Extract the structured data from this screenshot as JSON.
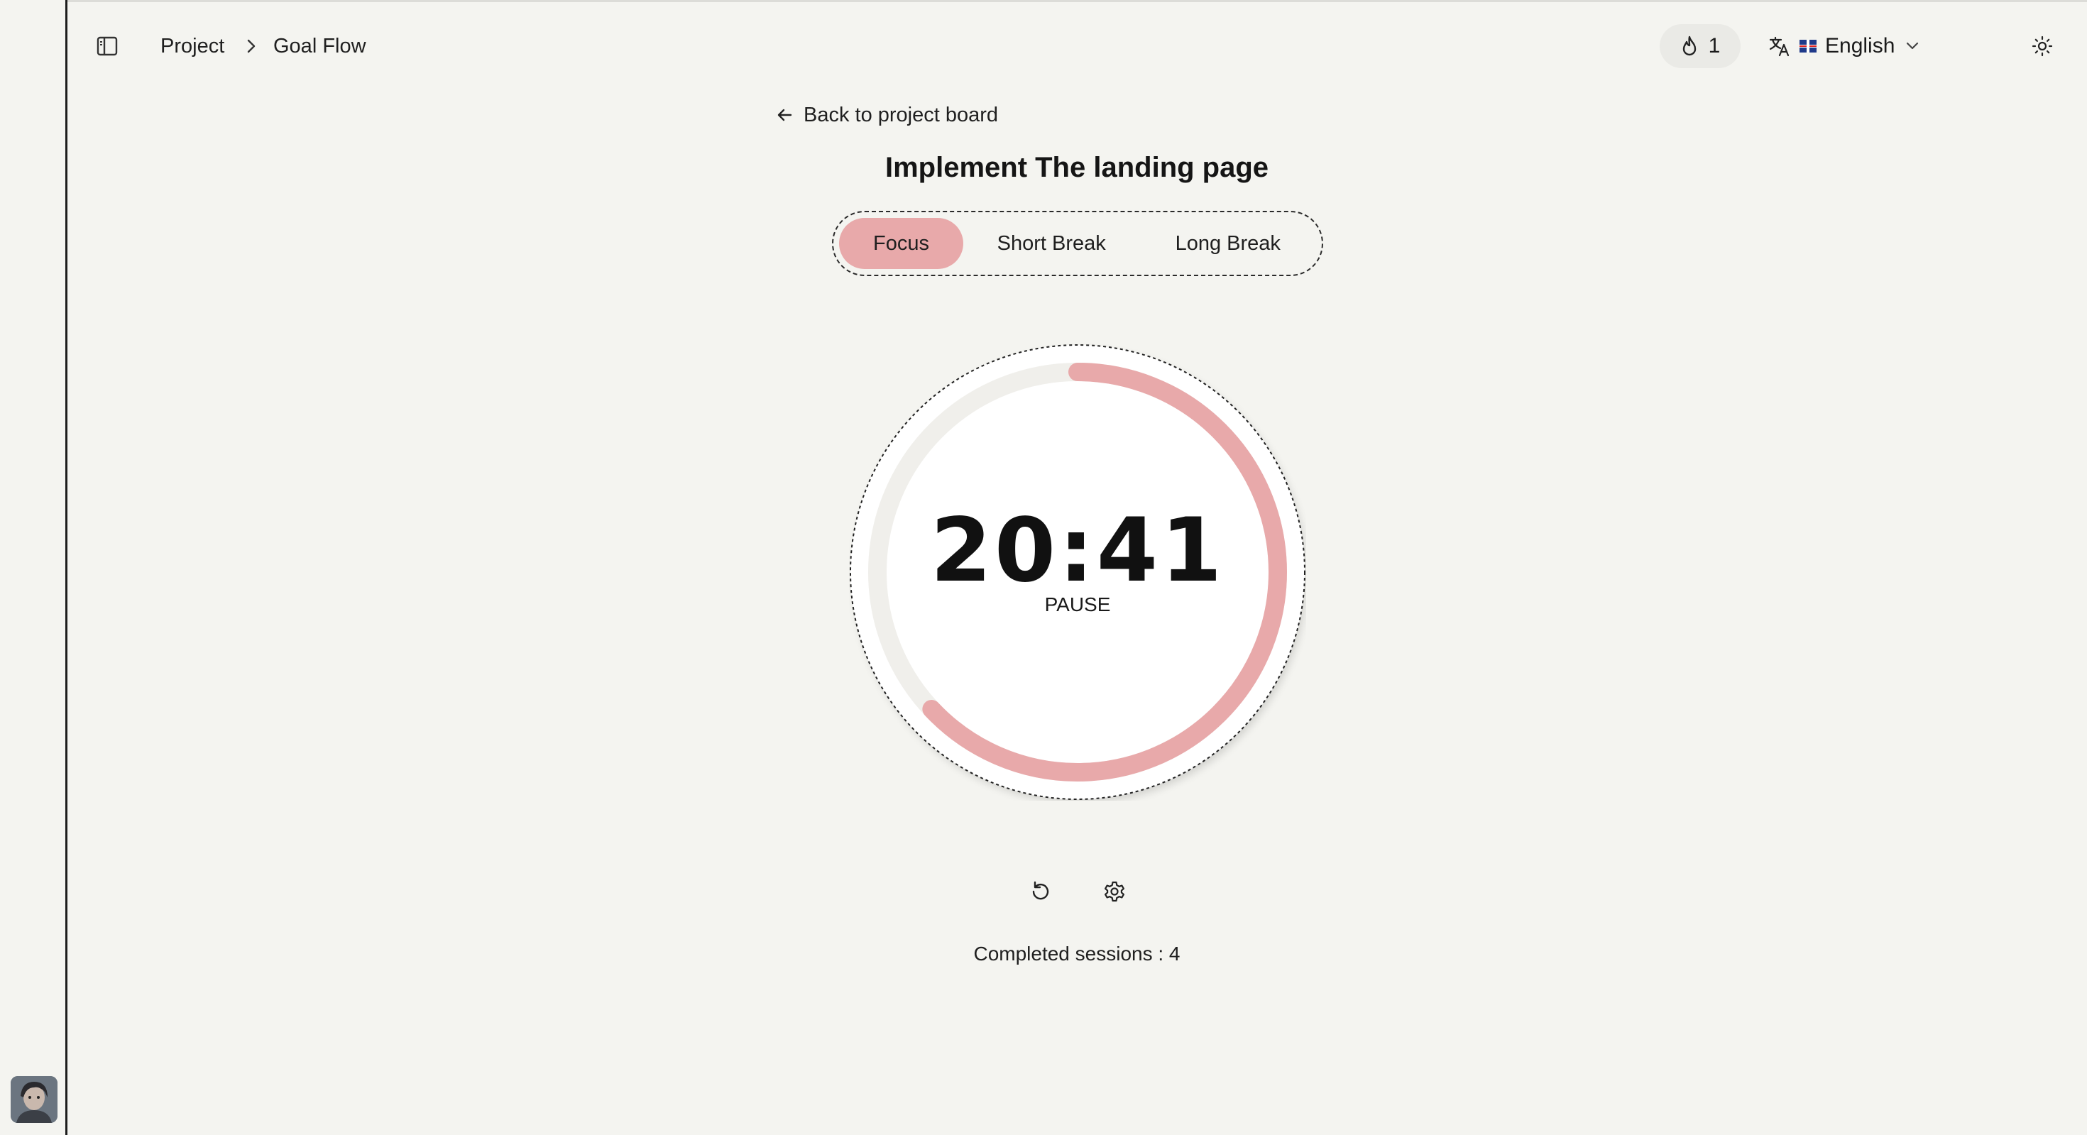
{
  "header": {
    "breadcrumb": [
      "Project",
      "Goal Flow"
    ],
    "streak_count": "1",
    "language": "English"
  },
  "icons": {
    "sidebar_toggle": "sidebar-toggle-icon",
    "breadcrumb_separator": "chevron-right-icon",
    "streak": "flame-icon",
    "translate": "translate-icon",
    "language_chevron": "chevron-down-icon",
    "theme": "sun-icon",
    "more": "more-horizontal-icon",
    "back": "arrow-left-icon",
    "reset": "rotate-ccw-icon",
    "settings": "gear-icon"
  },
  "main": {
    "back_label": "Back to project board",
    "task_title": "Implement The landing page",
    "tabs": [
      "Focus",
      "Short Break",
      "Long Break"
    ],
    "active_tab": "Focus",
    "timer": {
      "time": "20:41",
      "status": "PAUSE",
      "progress_fraction": 0.63
    },
    "sessions_label": "Completed sessions : 4"
  },
  "colors": {
    "accent": "#e8a9aa",
    "background": "#f4f4f0",
    "track": "#f0efeb"
  }
}
